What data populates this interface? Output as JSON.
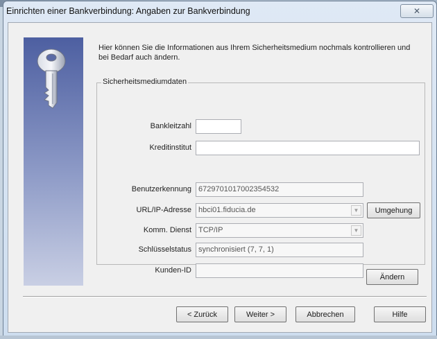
{
  "window": {
    "title": "Einrichten einer Bankverbindung: Angaben zur Bankverbindung",
    "close_glyph": "✕"
  },
  "intro": {
    "text": "Hier können Sie die Informationen aus Ihrem Sicherheitsmedium nochmals kontrollieren und bei Bedarf auch ändern."
  },
  "group": {
    "legend": "Sicherheitsmediumdaten",
    "fields": {
      "bankleitzahl": {
        "label": "Bankleitzahl",
        "value": ""
      },
      "kreditinstitut": {
        "label": "Kreditinstitut",
        "value": ""
      },
      "benutzerkennung": {
        "label": "Benutzerkennung",
        "value": "6729701017002354532"
      },
      "url_ip": {
        "label": "URL/IP-Adresse",
        "value": "hbci01.fiducia.de"
      },
      "komm_dienst": {
        "label": "Komm. Dienst",
        "value": "TCP/IP"
      },
      "schluesselstatus": {
        "label": "Schlüsselstatus",
        "value": "synchronisiert (7, 7, 1)"
      },
      "kunden_id": {
        "label": "Kunden-ID",
        "value": ""
      }
    }
  },
  "buttons": {
    "umgehung": "Umgehung",
    "aendern": "Ändern",
    "zurueck": "< Zurück",
    "weiter": "Weiter >",
    "abbrechen": "Abbrechen",
    "hilfe": "Hilfe"
  },
  "icons": {
    "key": "key-icon",
    "dropdown": "chevron-down-icon",
    "close": "close-icon"
  },
  "colors": {
    "panel_top": "#4d5fa1",
    "panel_bottom": "#c9cfe4",
    "dialog_bg": "#f0f0f0"
  }
}
